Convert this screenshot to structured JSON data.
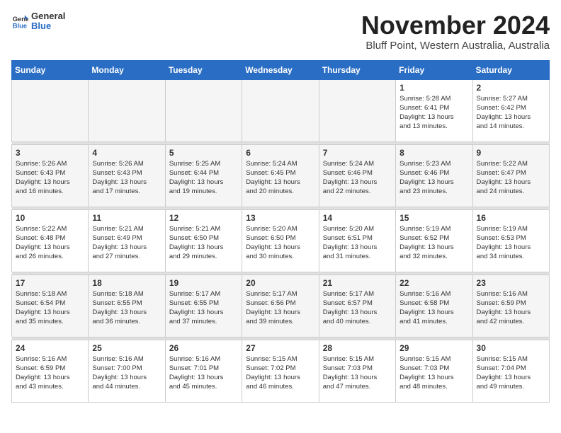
{
  "header": {
    "logo_general": "General",
    "logo_blue": "Blue",
    "title": "November 2024",
    "subtitle": "Bluff Point, Western Australia, Australia"
  },
  "weekdays": [
    "Sunday",
    "Monday",
    "Tuesday",
    "Wednesday",
    "Thursday",
    "Friday",
    "Saturday"
  ],
  "weeks": [
    [
      {
        "day": "",
        "info": ""
      },
      {
        "day": "",
        "info": ""
      },
      {
        "day": "",
        "info": ""
      },
      {
        "day": "",
        "info": ""
      },
      {
        "day": "",
        "info": ""
      },
      {
        "day": "1",
        "info": "Sunrise: 5:28 AM\nSunset: 6:41 PM\nDaylight: 13 hours\nand 13 minutes."
      },
      {
        "day": "2",
        "info": "Sunrise: 5:27 AM\nSunset: 6:42 PM\nDaylight: 13 hours\nand 14 minutes."
      }
    ],
    [
      {
        "day": "3",
        "info": "Sunrise: 5:26 AM\nSunset: 6:43 PM\nDaylight: 13 hours\nand 16 minutes."
      },
      {
        "day": "4",
        "info": "Sunrise: 5:26 AM\nSunset: 6:43 PM\nDaylight: 13 hours\nand 17 minutes."
      },
      {
        "day": "5",
        "info": "Sunrise: 5:25 AM\nSunset: 6:44 PM\nDaylight: 13 hours\nand 19 minutes."
      },
      {
        "day": "6",
        "info": "Sunrise: 5:24 AM\nSunset: 6:45 PM\nDaylight: 13 hours\nand 20 minutes."
      },
      {
        "day": "7",
        "info": "Sunrise: 5:24 AM\nSunset: 6:46 PM\nDaylight: 13 hours\nand 22 minutes."
      },
      {
        "day": "8",
        "info": "Sunrise: 5:23 AM\nSunset: 6:46 PM\nDaylight: 13 hours\nand 23 minutes."
      },
      {
        "day": "9",
        "info": "Sunrise: 5:22 AM\nSunset: 6:47 PM\nDaylight: 13 hours\nand 24 minutes."
      }
    ],
    [
      {
        "day": "10",
        "info": "Sunrise: 5:22 AM\nSunset: 6:48 PM\nDaylight: 13 hours\nand 26 minutes."
      },
      {
        "day": "11",
        "info": "Sunrise: 5:21 AM\nSunset: 6:49 PM\nDaylight: 13 hours\nand 27 minutes."
      },
      {
        "day": "12",
        "info": "Sunrise: 5:21 AM\nSunset: 6:50 PM\nDaylight: 13 hours\nand 29 minutes."
      },
      {
        "day": "13",
        "info": "Sunrise: 5:20 AM\nSunset: 6:50 PM\nDaylight: 13 hours\nand 30 minutes."
      },
      {
        "day": "14",
        "info": "Sunrise: 5:20 AM\nSunset: 6:51 PM\nDaylight: 13 hours\nand 31 minutes."
      },
      {
        "day": "15",
        "info": "Sunrise: 5:19 AM\nSunset: 6:52 PM\nDaylight: 13 hours\nand 32 minutes."
      },
      {
        "day": "16",
        "info": "Sunrise: 5:19 AM\nSunset: 6:53 PM\nDaylight: 13 hours\nand 34 minutes."
      }
    ],
    [
      {
        "day": "17",
        "info": "Sunrise: 5:18 AM\nSunset: 6:54 PM\nDaylight: 13 hours\nand 35 minutes."
      },
      {
        "day": "18",
        "info": "Sunrise: 5:18 AM\nSunset: 6:55 PM\nDaylight: 13 hours\nand 36 minutes."
      },
      {
        "day": "19",
        "info": "Sunrise: 5:17 AM\nSunset: 6:55 PM\nDaylight: 13 hours\nand 37 minutes."
      },
      {
        "day": "20",
        "info": "Sunrise: 5:17 AM\nSunset: 6:56 PM\nDaylight: 13 hours\nand 39 minutes."
      },
      {
        "day": "21",
        "info": "Sunrise: 5:17 AM\nSunset: 6:57 PM\nDaylight: 13 hours\nand 40 minutes."
      },
      {
        "day": "22",
        "info": "Sunrise: 5:16 AM\nSunset: 6:58 PM\nDaylight: 13 hours\nand 41 minutes."
      },
      {
        "day": "23",
        "info": "Sunrise: 5:16 AM\nSunset: 6:59 PM\nDaylight: 13 hours\nand 42 minutes."
      }
    ],
    [
      {
        "day": "24",
        "info": "Sunrise: 5:16 AM\nSunset: 6:59 PM\nDaylight: 13 hours\nand 43 minutes."
      },
      {
        "day": "25",
        "info": "Sunrise: 5:16 AM\nSunset: 7:00 PM\nDaylight: 13 hours\nand 44 minutes."
      },
      {
        "day": "26",
        "info": "Sunrise: 5:16 AM\nSunset: 7:01 PM\nDaylight: 13 hours\nand 45 minutes."
      },
      {
        "day": "27",
        "info": "Sunrise: 5:15 AM\nSunset: 7:02 PM\nDaylight: 13 hours\nand 46 minutes."
      },
      {
        "day": "28",
        "info": "Sunrise: 5:15 AM\nSunset: 7:03 PM\nDaylight: 13 hours\nand 47 minutes."
      },
      {
        "day": "29",
        "info": "Sunrise: 5:15 AM\nSunset: 7:03 PM\nDaylight: 13 hours\nand 48 minutes."
      },
      {
        "day": "30",
        "info": "Sunrise: 5:15 AM\nSunset: 7:04 PM\nDaylight: 13 hours\nand 49 minutes."
      }
    ]
  ]
}
